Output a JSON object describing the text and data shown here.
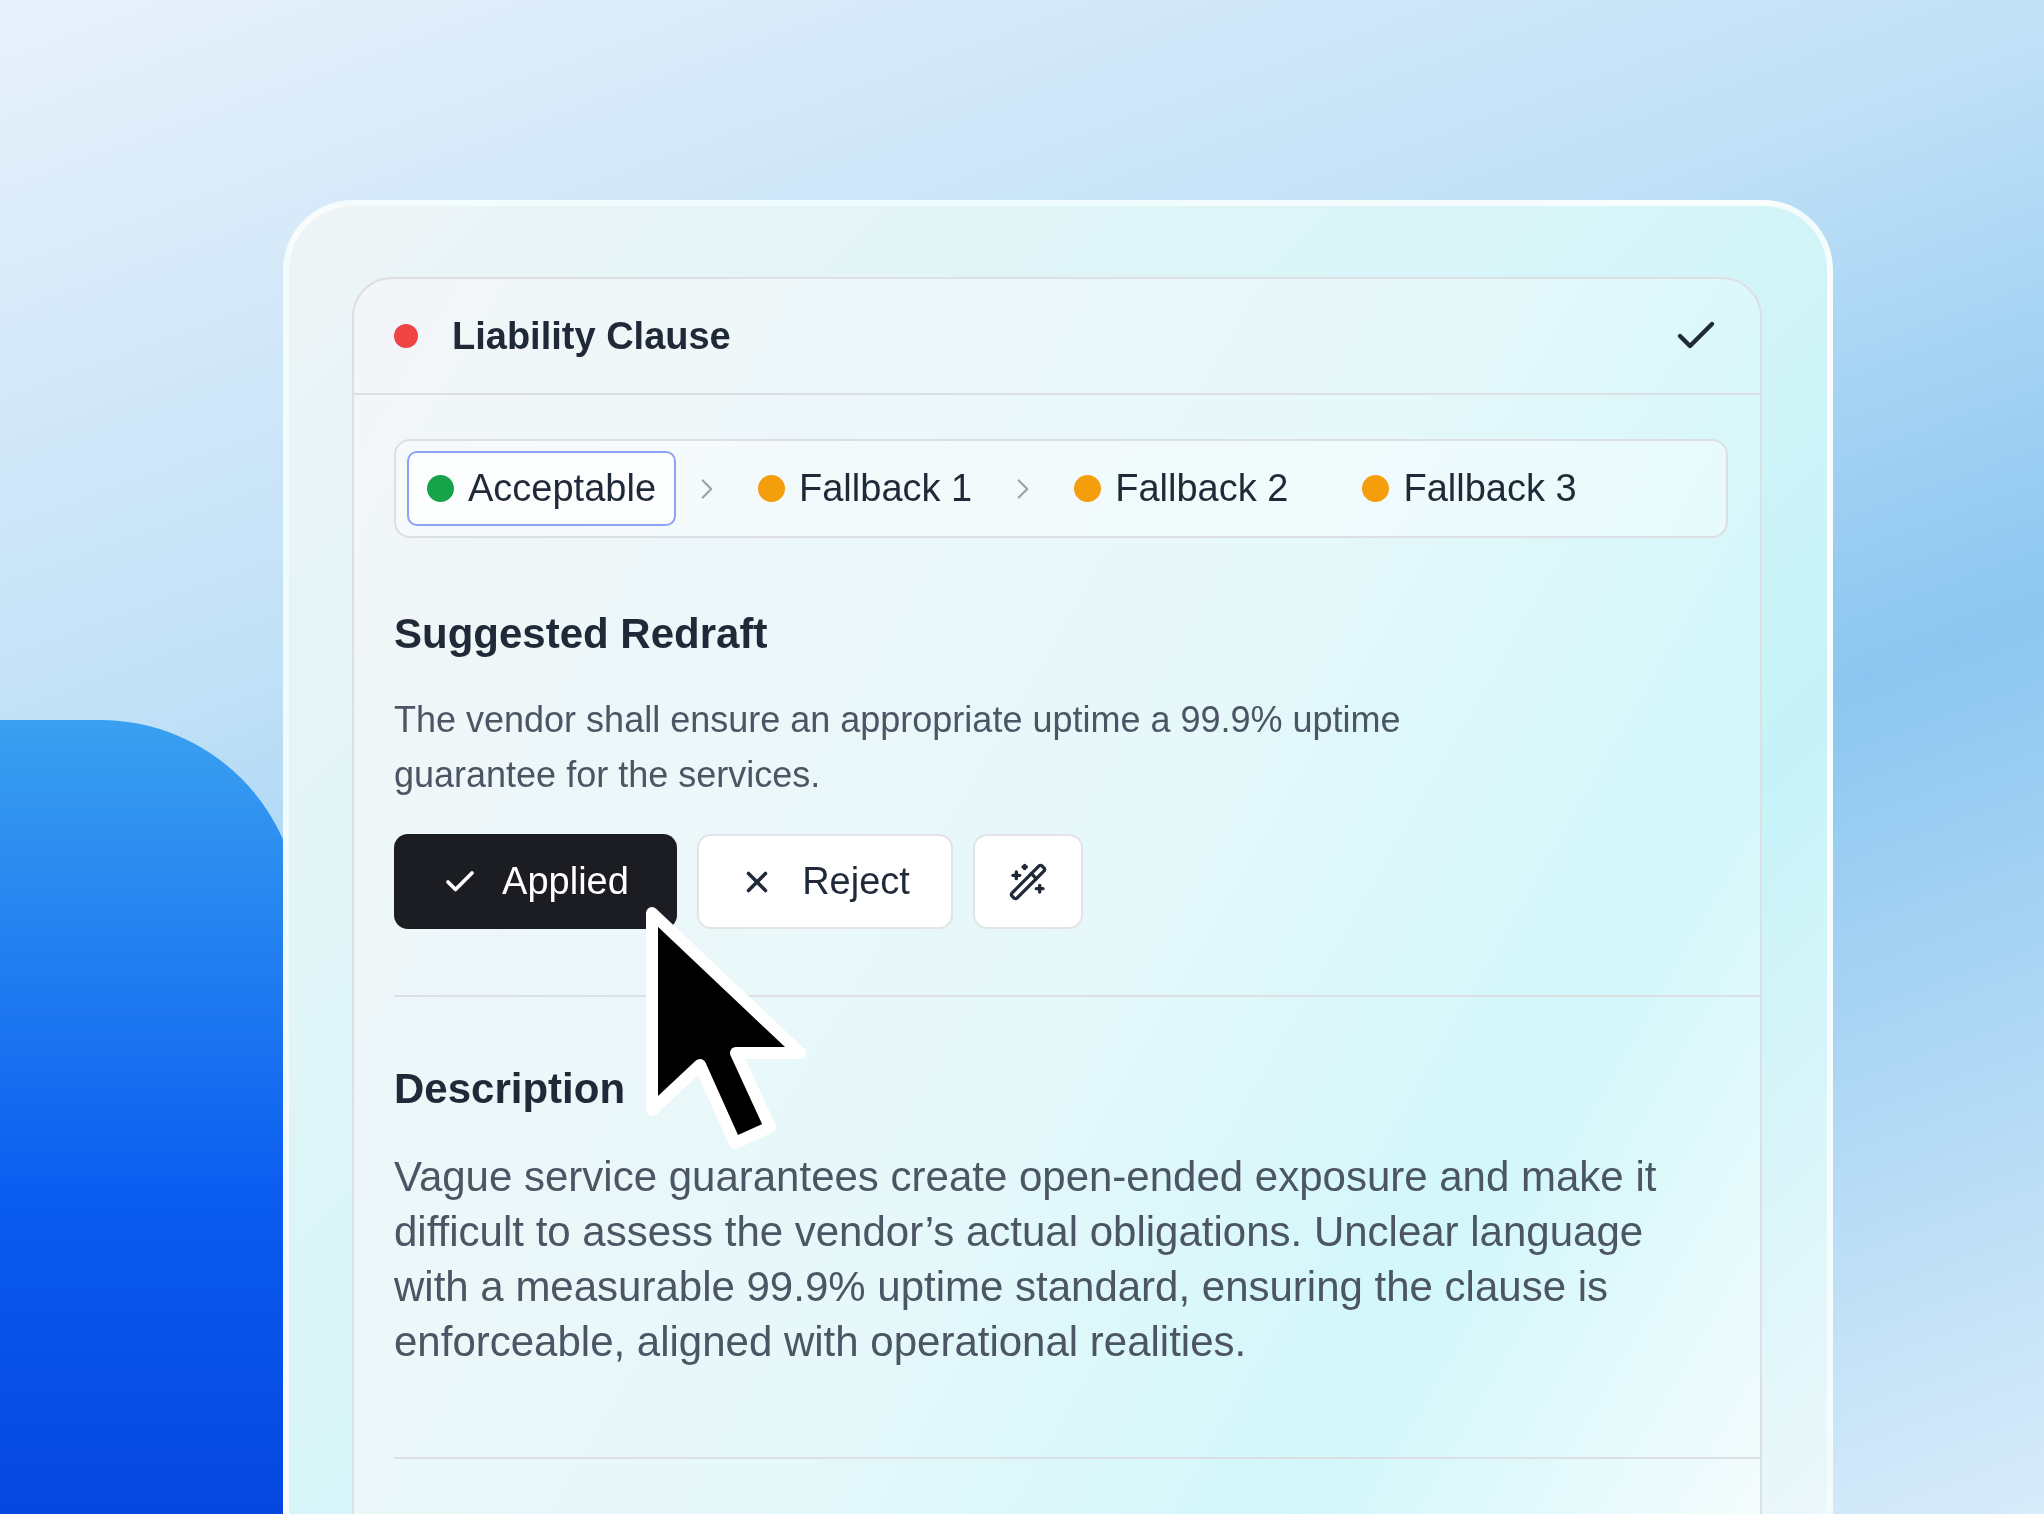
{
  "card": {
    "title": "Liability Clause",
    "color": "#ef4444"
  },
  "steps": [
    {
      "kind": "tab",
      "label": "Acceptable",
      "color": "#16a34a",
      "selected": true
    },
    {
      "kind": "chevron"
    },
    {
      "kind": "tab",
      "label": "Fallback 1",
      "color": "#f59e0b",
      "selected": false
    },
    {
      "kind": "chevron"
    },
    {
      "kind": "tab",
      "label": "Fallback 2",
      "color": "#f59e0b",
      "selected": false
    },
    {
      "kind": "tab",
      "label": "Fallback 3",
      "color": "#f59e0b",
      "selected": false
    }
  ],
  "redraft": {
    "heading": "Suggested Redraft",
    "text": "The vendor shall ensure an appropriate uptime a 99.9% uptime guarantee for the services."
  },
  "buttons": [
    {
      "kind": "applied",
      "label": "Applied"
    },
    {
      "kind": "reject",
      "label": "Reject"
    },
    {
      "kind": "wand"
    }
  ],
  "description": {
    "heading": "Description",
    "text": "Vague service guarantees create open-ended exposure and make it difficult to assess the vendor’s actual obligations. Unclear language with a measurable 99.9% uptime standard, ensuring the clause is enforceable, aligned with operational realities."
  }
}
